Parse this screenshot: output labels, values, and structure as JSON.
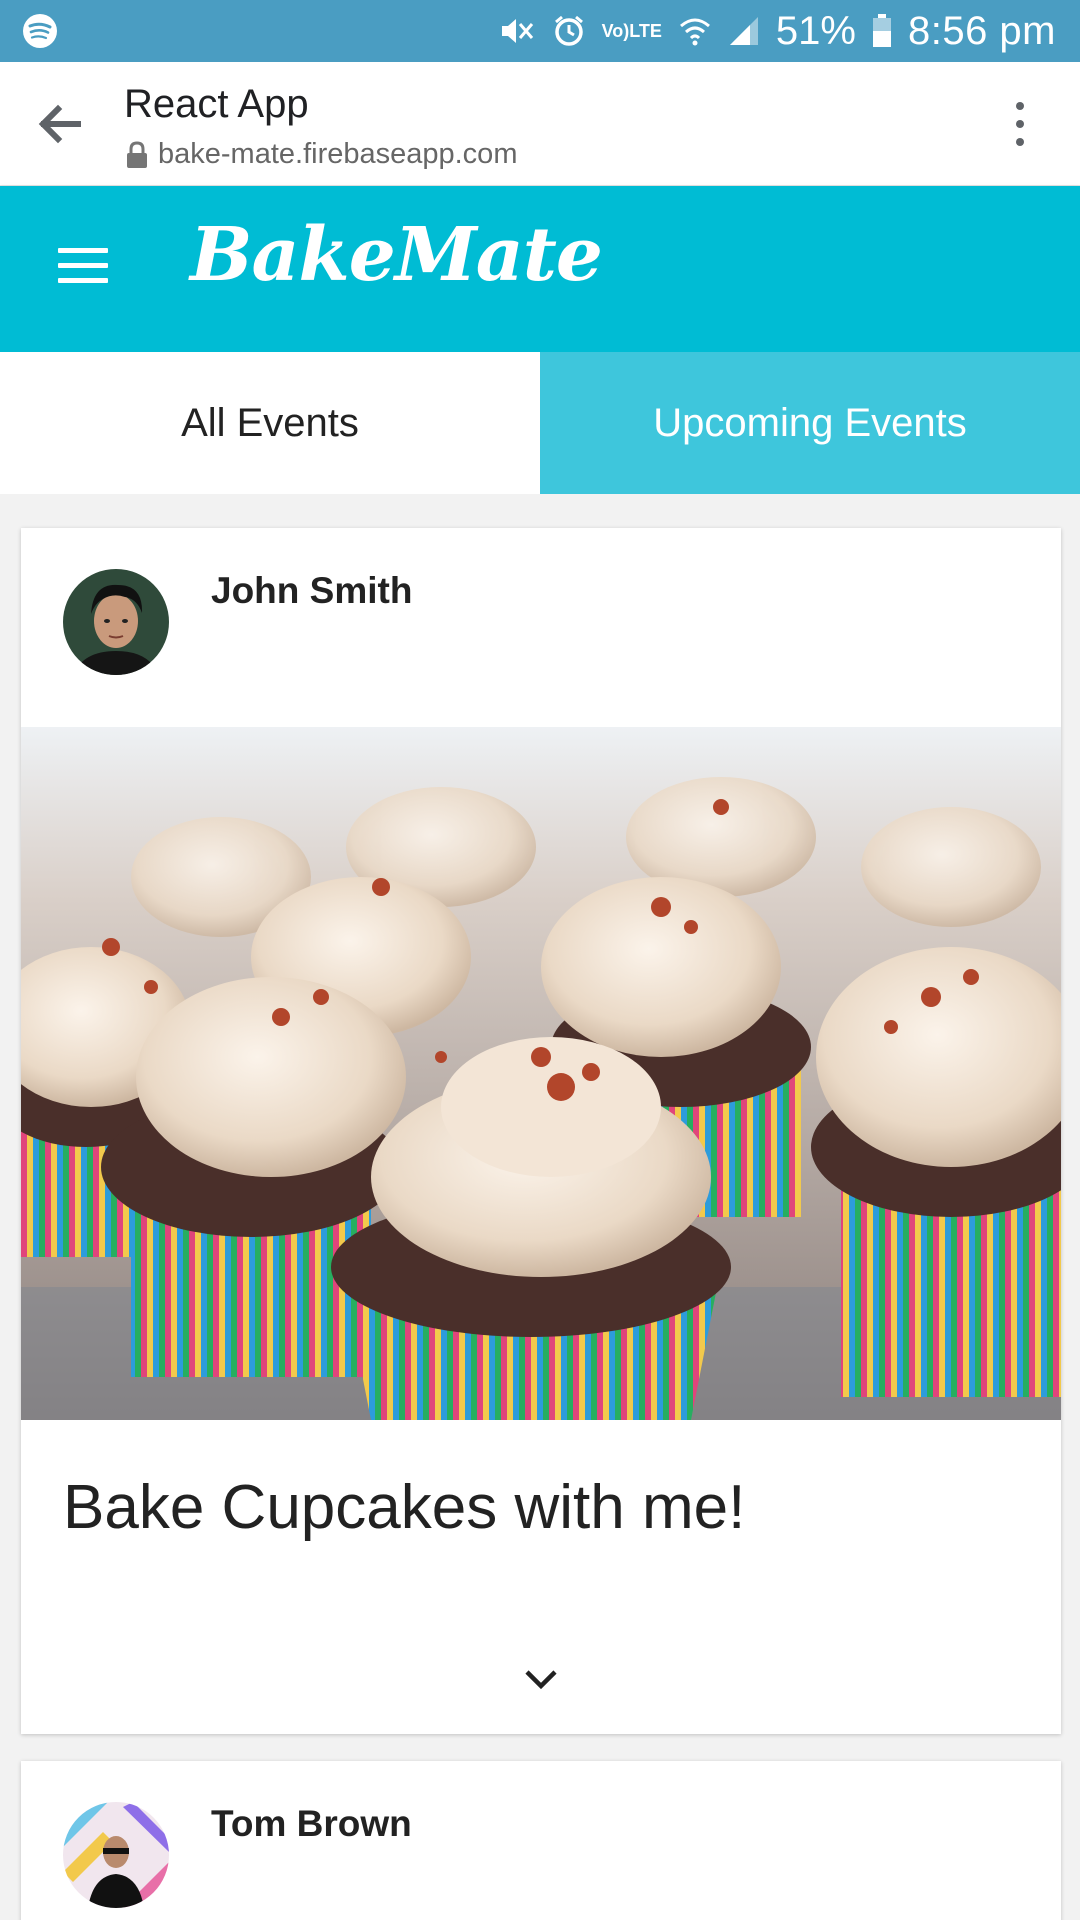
{
  "status_bar": {
    "battery": "51%",
    "time": "8:56 pm",
    "network_label_top": "Vo)",
    "network_label_bottom": "LTE"
  },
  "browser": {
    "title": "React App",
    "url": "bake-mate.firebaseapp.com"
  },
  "app": {
    "brand": "BakeMate"
  },
  "tabs": [
    {
      "label": "All Events"
    },
    {
      "label": "Upcoming Events"
    }
  ],
  "events": [
    {
      "author": "John Smith",
      "title": "Bake Cupcakes with me!"
    },
    {
      "author": "Tom Brown"
    }
  ],
  "colors": {
    "status_bar": "#4a9dc2",
    "accent": "#00bcd4",
    "active_tab": "#3ec6dc"
  }
}
